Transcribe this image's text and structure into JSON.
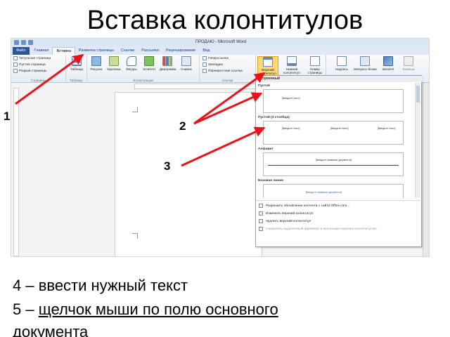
{
  "slide": {
    "title": "Вставка колонтитулов",
    "step4": "4 – ввести нужный текст",
    "step5_prefix": "5 – ",
    "step5_action": "щелчок мыши по полю основного",
    "step5_cont": "документа"
  },
  "annotations": {
    "n1": "1",
    "n2": "2",
    "n3": "3",
    "arrow_color": "#e8141c"
  },
  "word": {
    "window_title": "ПРОДАЮ - Microsoft Word",
    "tabs": [
      "Файл",
      "Главная",
      "Вставка",
      "Разметка страницы",
      "Ссылки",
      "Рассылки",
      "Рецензирование",
      "Вид"
    ],
    "active_tab": "Вставка",
    "ribbon": {
      "pages": [
        "Титульная страница",
        "Пустая страница",
        "Разрыв страницы"
      ],
      "pages_group": "Страницы",
      "table_btn": "Таблица",
      "tables_group": "Таблицы",
      "illustrations": [
        "Рисунок",
        "Картинка",
        "Фигуры",
        "SmartArt",
        "Диаграмма",
        "Снимок"
      ],
      "illustrations_group": "Иллюстрации",
      "links": [
        "Гиперссылка",
        "Закладка",
        "Перекрестная ссылка"
      ],
      "links_group": "Ссылки",
      "hf_buttons": [
        "Верхний колонтитул",
        "Нижний колонтитул",
        "Номер страницы"
      ],
      "text_buttons": [
        "Надпись",
        "Экспресс-блоки",
        "WordArt",
        "Буквица"
      ],
      "accent": "#fbd878"
    },
    "gallery": {
      "header": "Встроенный",
      "items": [
        {
          "name": "Пустой",
          "placeholders": [
            "[Введите текст]"
          ]
        },
        {
          "name": "Пустой (3 столбца)",
          "placeholders": [
            "[Введите текст]",
            "[Введите текст]",
            "[Введите текст]"
          ]
        },
        {
          "name": "Алфавит",
          "placeholders": [
            "[Введите название документа]"
          ]
        },
        {
          "name": "Боковая линия",
          "placeholders": [
            "[Введите название документа]"
          ]
        }
      ],
      "menu": [
        {
          "label": "Разрешить обновление контента с сайта Office.com...",
          "enabled": true
        },
        {
          "label": "Изменить верхний колонтитул",
          "enabled": true
        },
        {
          "label": "Удалить верхний колонтитул",
          "enabled": true
        },
        {
          "label": "Сохранить выделенный фрагмент в коллекцию верхних колонтитулов...",
          "enabled": false
        }
      ]
    }
  }
}
